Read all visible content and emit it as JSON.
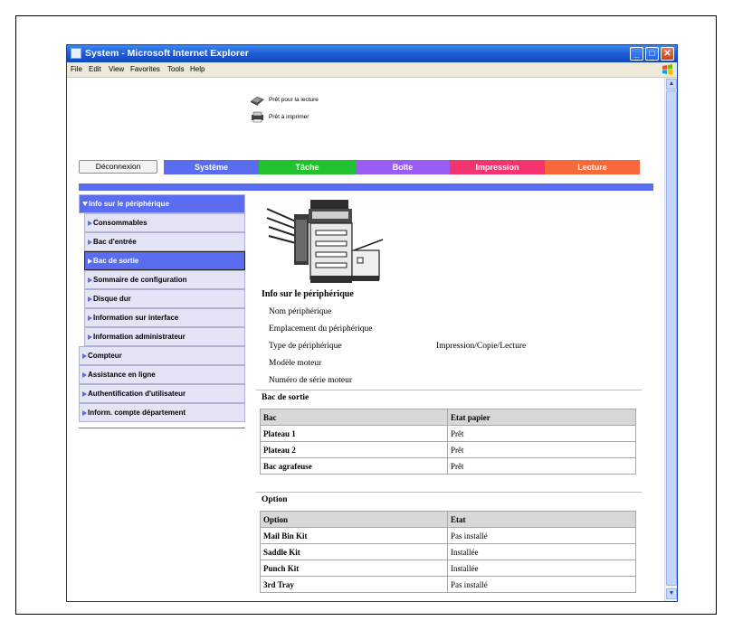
{
  "window": {
    "title": "System - Microsoft Internet Explorer",
    "controls": [
      "minimize",
      "maximize",
      "close"
    ]
  },
  "menubar": {
    "items": [
      "File",
      "Edit",
      "View",
      "Favorites",
      "Tools",
      "Help"
    ]
  },
  "status": {
    "scan": "Prêt pour la lecture",
    "print": "Prêt à imprimer"
  },
  "tabs": {
    "logout": "Déconnexion",
    "items": [
      {
        "label": "Système",
        "color": "#5a6cf0"
      },
      {
        "label": "Tâche",
        "color": "#21c130"
      },
      {
        "label": "Boîte",
        "color": "#9a5cf5"
      },
      {
        "label": "Impression",
        "color": "#f5336f"
      },
      {
        "label": "Lecture",
        "color": "#f7693a"
      }
    ]
  },
  "sidebar": {
    "items": [
      {
        "label": "Info sur le périphérique",
        "kind": "head"
      },
      {
        "label": "Consommables",
        "kind": "sub"
      },
      {
        "label": "Bac d'entrée",
        "kind": "sub"
      },
      {
        "label": "Bac de sortie",
        "kind": "sub-active"
      },
      {
        "label": "Sommaire de configuration",
        "kind": "sub"
      },
      {
        "label": "Disque dur",
        "kind": "sub"
      },
      {
        "label": "Information sur interface",
        "kind": "sub"
      },
      {
        "label": "Information administrateur",
        "kind": "sub"
      },
      {
        "label": "Compteur",
        "kind": "top"
      },
      {
        "label": "Assistance en ligne",
        "kind": "top"
      },
      {
        "label": "Authentification d'utilisateur",
        "kind": "top"
      },
      {
        "label": "Inform. compte département",
        "kind": "top"
      }
    ]
  },
  "device_info": {
    "title": "Info sur le périphérique",
    "rows": [
      {
        "label": "Nom périphérique",
        "value": ""
      },
      {
        "label": "Emplacement du périphérique",
        "value": ""
      },
      {
        "label": "Type de périphérique",
        "value": "Impression/Copie/Lecture"
      },
      {
        "label": "Modèle moteur",
        "value": ""
      },
      {
        "label": "Numéro de série moteur",
        "value": ""
      }
    ]
  },
  "output_tray": {
    "title": "Bac de sortie",
    "headers": [
      "Bac",
      "Etat papier"
    ],
    "rows": [
      [
        "Plateau 1",
        "Prêt"
      ],
      [
        "Plateau 2",
        "Prêt"
      ],
      [
        "Bac agrafeuse",
        "Prêt"
      ]
    ]
  },
  "options": {
    "title": "Option",
    "headers": [
      "Option",
      "Etat"
    ],
    "rows": [
      [
        "Mail Bin Kit",
        "Pas installé"
      ],
      [
        "Saddle Kit",
        "Installée"
      ],
      [
        "Punch Kit",
        "Installée"
      ],
      [
        "3rd Tray",
        "Pas installé"
      ]
    ]
  }
}
